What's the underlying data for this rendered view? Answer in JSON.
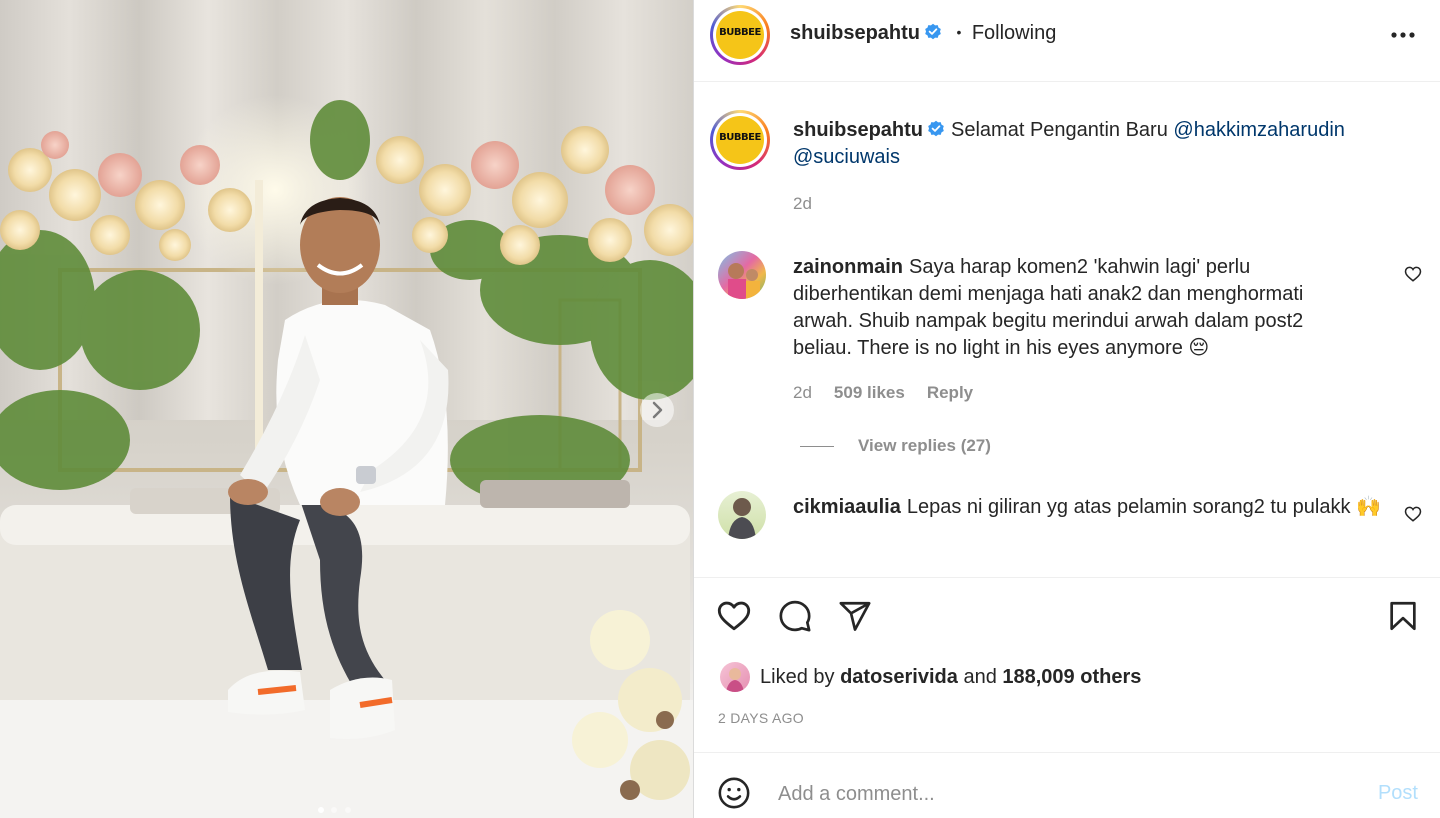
{
  "post": {
    "username": "shuibsepahtu",
    "logo_text": "BUBBEE",
    "separator": "•",
    "follow_label": "Following",
    "more_label": "•••"
  },
  "caption": {
    "username": "shuibsepahtu",
    "text": "Selamat Pengantin Baru ",
    "mention1": "@hakkimzaharudin",
    "mention2": "@suciuwais",
    "age": "2d"
  },
  "comments": [
    {
      "username": "zainonmain",
      "text": "Saya harap komen2 'kahwin lagi' perlu diberhentikan demi menjaga hati anak2 dan menghormati arwah. Shuib nampak begitu merindui arwah dalam post2 beliau. There is no light in his eyes anymore 😔",
      "age": "2d",
      "likes": "509 likes",
      "reply_label": "Reply",
      "view_replies": "View replies (27)"
    },
    {
      "username": "cikmiaaulia",
      "text": "Lepas ni giliran yg atas pelamin sorang2 tu pulakk 🙌",
      "age": "",
      "likes": "",
      "reply_label": ""
    }
  ],
  "likes": {
    "prefix": "Liked by ",
    "user": "datoserivida",
    "middle": " and ",
    "count": "188,009 others"
  },
  "timestamp": "2 DAYS AGO",
  "comment_input": {
    "placeholder": "Add a comment...",
    "post_label": "Post"
  },
  "colors": {
    "link": "#00376b",
    "muted": "#8e8e8e",
    "verified": "#3897f0",
    "post_disabled": "#b2dffc"
  },
  "carousel": {
    "current": 1,
    "total": 3
  }
}
